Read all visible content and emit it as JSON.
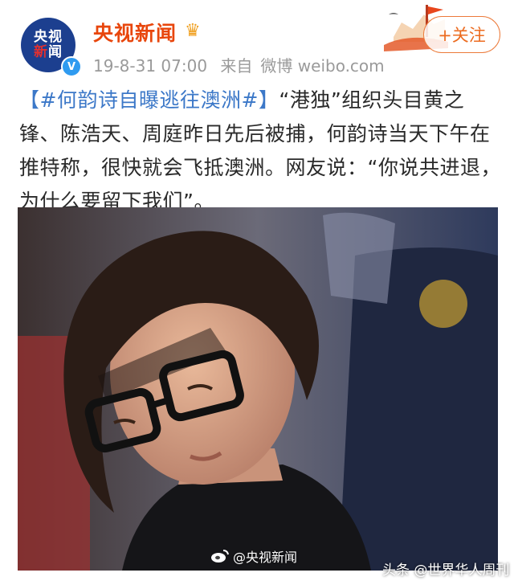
{
  "account": {
    "avatar_line1": "央视",
    "avatar_line2a": "新",
    "avatar_line2b": "闻",
    "name": "央视新闻",
    "verified_icon": "verified-badge-icon",
    "crown_icon": "crown-icon"
  },
  "meta": {
    "date": "19-8-31 07:00",
    "source_prefix": "来自",
    "source": "微博 weibo.com"
  },
  "follow_button": {
    "label": "+关注"
  },
  "post": {
    "hashtag": "【#何韵诗自曝逃往澳洲#】",
    "body": "“港独”组织头目黄之锋、陈浩天、周庭昨日先后被捕，何韵诗当天下午在推特称，很快就会飞抵澳洲。网友说：“你说共进退，为什么要留下我们”。"
  },
  "photo": {
    "watermark": "@央视新闻",
    "watermark_icon": "weibo-logo-icon"
  },
  "footer": {
    "source_credit": "头条 @世界华人周刊"
  },
  "colors": {
    "brand_orange": "#e8460c",
    "hashtag_blue": "#3c78c8",
    "meta_grey": "#9a9a9a"
  }
}
